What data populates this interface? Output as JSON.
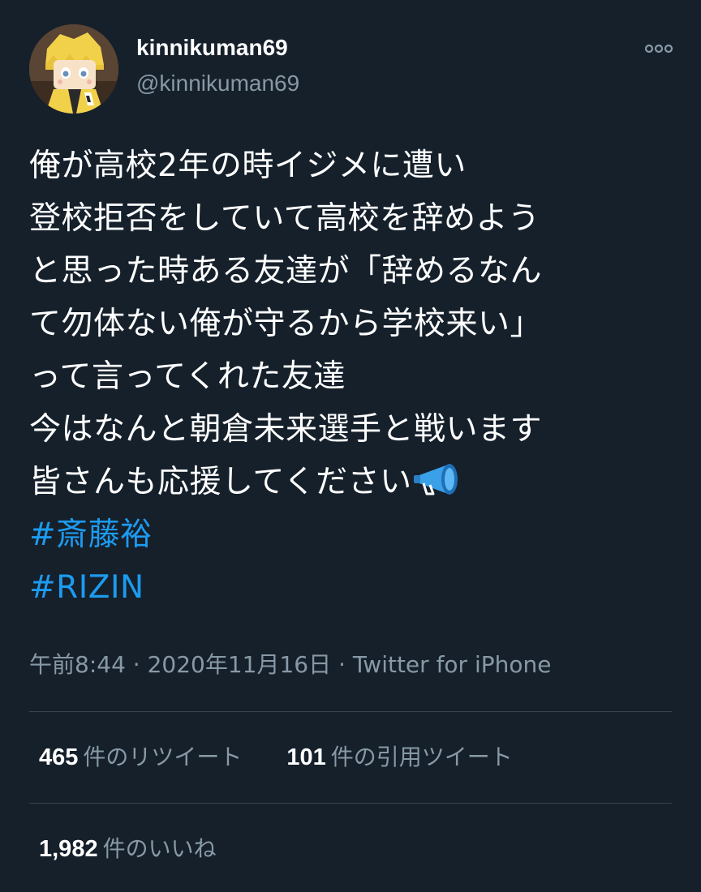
{
  "user": {
    "display_name": "kinnikuman69",
    "handle": "@kinnikuman69"
  },
  "icons": {
    "avatar": "origami-character-avatar",
    "more": "more-dots-icon",
    "emoji": "megaphone-icon"
  },
  "colors": {
    "background": "#15202b",
    "text": "#ffffff",
    "secondary": "#8899a6",
    "link": "#1d9bf0",
    "divider": "#38444d"
  },
  "tweet": {
    "lines": [
      "俺が高校2年の時イジメに遭い",
      "登校拒否をしていて高校を辞めよう",
      "と思った時ある友達が「辞めるなん",
      "て勿体ない俺が守るから学校来い」",
      "って言ってくれた友達",
      "今はなんと朝倉未来選手と戦います",
      "皆さんも応援してください"
    ],
    "hashtags": [
      "#斎藤裕",
      "#RIZIN"
    ]
  },
  "meta": {
    "time": "午前8:44",
    "separator": " · ",
    "date": "2020年11月16日",
    "source": "Twitter for iPhone"
  },
  "stats": {
    "retweets_count": "465",
    "retweets_label": "件のリツイート",
    "quotes_count": "101",
    "quotes_label": "件の引用ツイート",
    "likes_count": "1,982",
    "likes_label": "件のいいね"
  }
}
